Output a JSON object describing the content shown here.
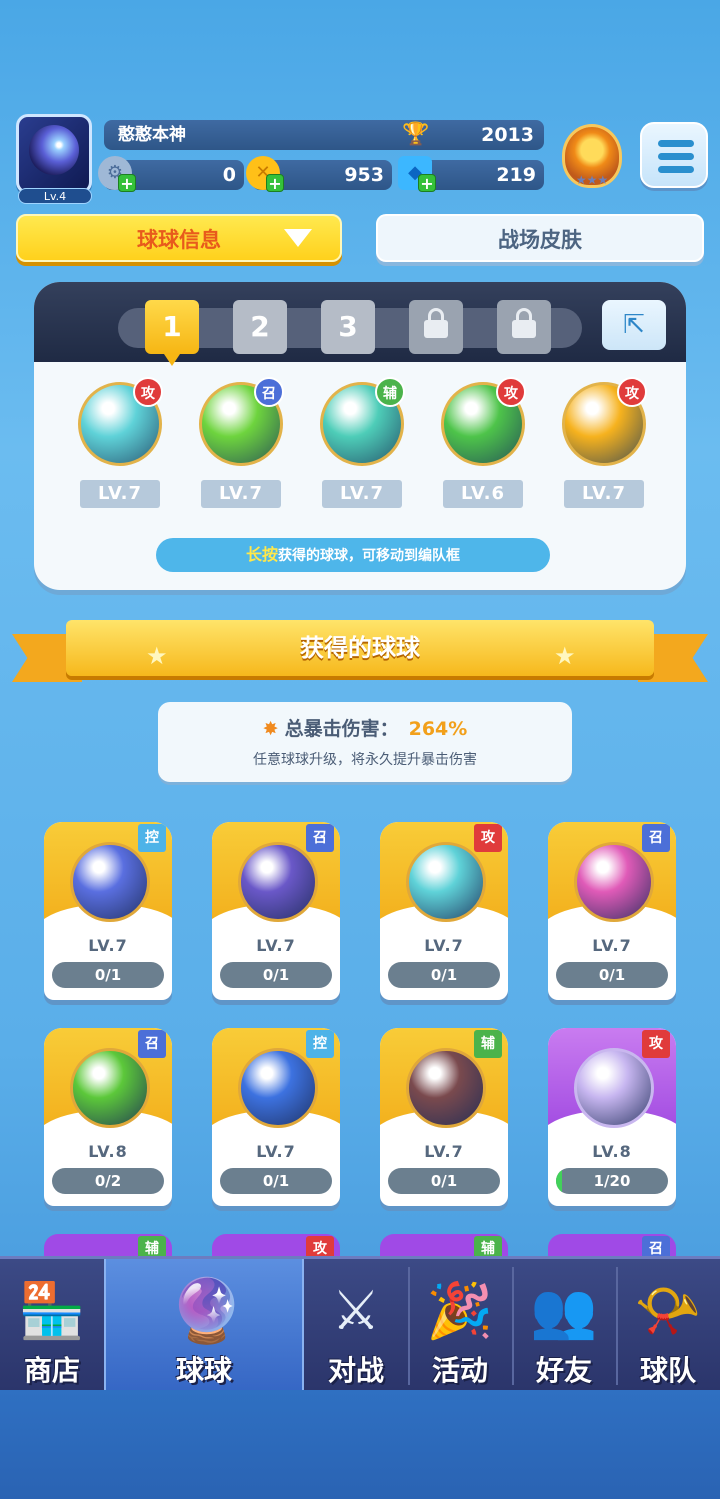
{
  "player": {
    "name": "憨憨本神",
    "level": "Lv.4",
    "trophies": "2013"
  },
  "currencies": [
    {
      "value": "0",
      "icon": "gear-coin-icon"
    },
    {
      "value": "953",
      "icon": "gold-coin-icon"
    },
    {
      "value": "219",
      "icon": "diamond-icon"
    }
  ],
  "tabs": {
    "ball_info": "球球信息",
    "skins": "战场皮肤"
  },
  "formation": {
    "slots": [
      "1",
      "2",
      "3"
    ],
    "balls": [
      {
        "tag": "攻",
        "level": "LV.7",
        "color": "#5fd2d8"
      },
      {
        "tag": "召",
        "level": "LV.7",
        "color": "#6ed43e"
      },
      {
        "tag": "辅",
        "level": "LV.7",
        "color": "#4ecdb8"
      },
      {
        "tag": "攻",
        "level": "LV.6",
        "color": "#4ec44a"
      },
      {
        "tag": "攻",
        "level": "LV.7",
        "color": "#f6b21e"
      }
    ],
    "hint_highlight": "长按",
    "hint_text": "获得的球球，可移动到编队框"
  },
  "obtained": {
    "title": "获得的球球",
    "crit_label": "总暴击伤害：",
    "crit_value": "264%",
    "crit_sub": "任意球球升级，将永久提升暴击伤害"
  },
  "cards": [
    {
      "tag": "控",
      "level": "LV.7",
      "progress": "0/1",
      "fill": 0,
      "color": "#5a6fe0",
      "theme": "gold"
    },
    {
      "tag": "召",
      "level": "LV.7",
      "progress": "0/1",
      "fill": 0,
      "color": "#6a58c8",
      "theme": "gold"
    },
    {
      "tag": "攻",
      "level": "LV.7",
      "progress": "0/1",
      "fill": 0,
      "color": "#5fd2d8",
      "theme": "gold"
    },
    {
      "tag": "召",
      "level": "LV.7",
      "progress": "0/1",
      "fill": 0,
      "color": "#e05bb8",
      "theme": "gold"
    },
    {
      "tag": "召",
      "level": "LV.8",
      "progress": "0/2",
      "fill": 0,
      "color": "#5cc83a",
      "theme": "gold"
    },
    {
      "tag": "控",
      "level": "LV.7",
      "progress": "0/1",
      "fill": 0,
      "color": "#3d72e0",
      "theme": "gold"
    },
    {
      "tag": "辅",
      "level": "LV.7",
      "progress": "0/1",
      "fill": 0,
      "color": "#7a4a4e",
      "theme": "gold"
    },
    {
      "tag": "攻",
      "level": "LV.8",
      "progress": "1/20",
      "fill": 0.05,
      "color": "#c7b6f0",
      "theme": "purple"
    }
  ],
  "partial_tags": [
    "辅",
    "攻",
    "辅",
    "召"
  ],
  "nav": [
    {
      "label": "商店",
      "icon": "shop-icon",
      "glyph": "🏪"
    },
    {
      "label": "球球",
      "icon": "balls-icon",
      "glyph": "🔮"
    },
    {
      "label": "对战",
      "icon": "crossed-swords-icon",
      "glyph": "⚔"
    },
    {
      "label": "活动",
      "icon": "party-popper-icon",
      "glyph": "🎉"
    },
    {
      "label": "好友",
      "icon": "friends-book-icon",
      "glyph": "👥"
    },
    {
      "label": "球队",
      "icon": "whistle-icon",
      "glyph": "📯"
    }
  ]
}
